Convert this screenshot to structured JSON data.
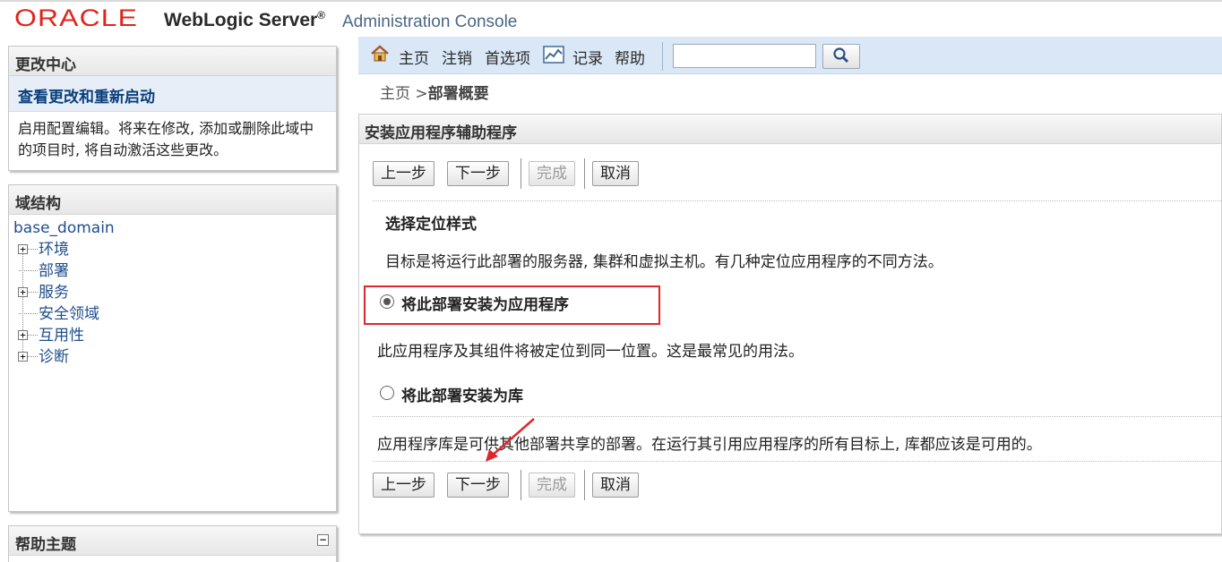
{
  "header": {
    "brand": "ORACLE",
    "product": "WebLogic Server",
    "registered": "®",
    "subtitle": "Administration Console"
  },
  "change_center": {
    "title": "更改中心",
    "link": "查看更改和重新启动",
    "description": "启用配置编辑。将来在修改, 添加或删除此域中的项目时, 将自动激活这些更改。"
  },
  "domain_structure": {
    "title": "域结构",
    "root": "base_domain",
    "items": [
      {
        "label": "环境",
        "expandable": true
      },
      {
        "label": "部署",
        "expandable": false
      },
      {
        "label": "服务",
        "expandable": true
      },
      {
        "label": "安全领域",
        "expandable": false
      },
      {
        "label": "互用性",
        "expandable": true
      },
      {
        "label": "诊断",
        "expandable": true
      }
    ]
  },
  "help_topics": {
    "title": "帮助主题",
    "collapse_symbol": "−"
  },
  "toolbar": {
    "home": "主页",
    "logout": "注销",
    "preferences": "首选项",
    "record": "记录",
    "help": "帮助",
    "search_value": "",
    "search_placeholder": ""
  },
  "breadcrumb": {
    "home": "主页",
    "separator": " >",
    "current": "部署概要"
  },
  "wizard": {
    "title": "安装应用程序辅助程序",
    "buttons": {
      "back": "上一步",
      "next": "下一步",
      "finish": "完成",
      "cancel": "取消"
    },
    "section_heading": "选择定位样式",
    "section_description": "目标是将运行此部署的服务器, 集群和虚拟主机。有几种定位应用程序的不同方法。",
    "options": [
      {
        "label": "将此部署安装为应用程序",
        "selected": true,
        "description": "此应用程序及其组件将被定位到同一位置。这是最常见的用法。"
      },
      {
        "label": "将此部署安装为库",
        "selected": false,
        "description": "应用程序库是可供其他部署共享的部署。在运行其引用应用程序的所有目标上, 库都应该是可用的。"
      }
    ]
  },
  "colors": {
    "brand_red": "#e2231a",
    "link_blue": "#1f4e8c",
    "toolbar_bg": "#d9e7f6",
    "highlight_red": "#e0252b"
  }
}
